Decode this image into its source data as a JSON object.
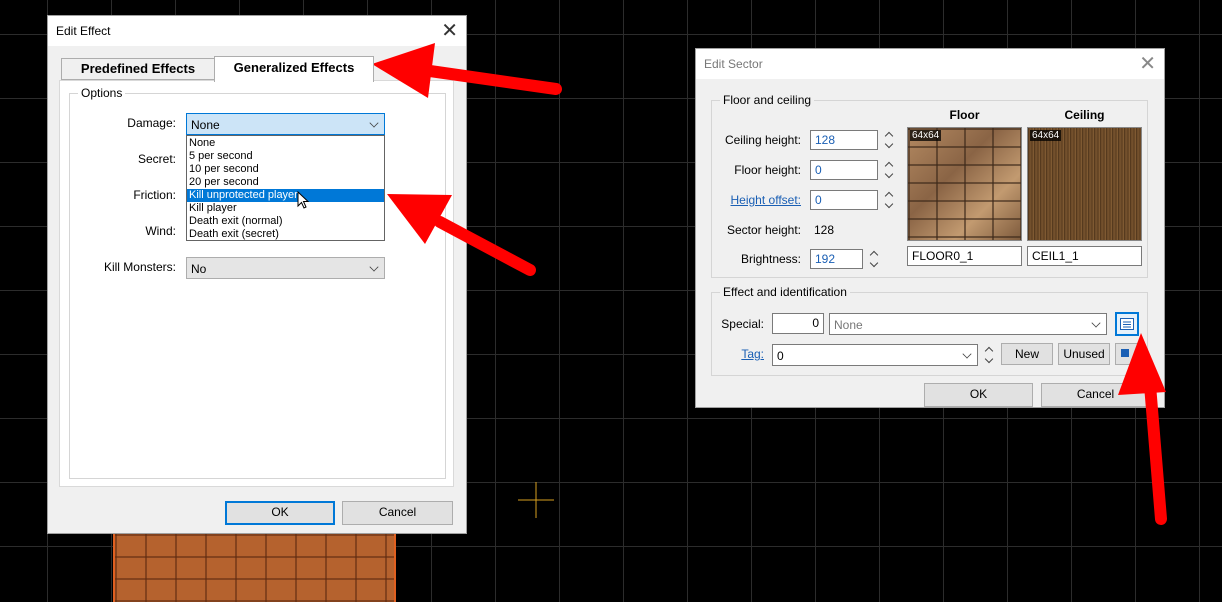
{
  "edit_effect": {
    "title": "Edit Effect",
    "close": "✕",
    "tabs": [
      "Predefined Effects",
      "Generalized Effects"
    ],
    "options_label": "Options",
    "damage_label": "Damage:",
    "damage_value": "None",
    "damage_options": [
      "None",
      "5 per second",
      "10 per second",
      "20 per second",
      "Kill unprotected player",
      "Kill player",
      "Death exit (normal)",
      "Death exit (secret)"
    ],
    "secret_label": "Secret:",
    "friction_label": "Friction:",
    "wind_label": "Wind:",
    "kill_monsters_label": "Kill Monsters:",
    "kill_monsters_value": "No",
    "ok": "OK",
    "cancel": "Cancel"
  },
  "edit_sector": {
    "title": "Edit Sector",
    "close": "✕",
    "floor_ceiling_label": "Floor and ceiling",
    "ceiling_height_label": "Ceiling height:",
    "ceiling_height": "128",
    "floor_height_label": "Floor height:",
    "floor_height": "0",
    "height_offset_label": "Height offset:",
    "height_offset": "0",
    "sector_height_label": "Sector height:",
    "sector_height": "128",
    "brightness_label": "Brightness:",
    "brightness": "192",
    "floor_header": "Floor",
    "ceiling_header": "Ceiling",
    "floor_size": "64x64",
    "ceiling_size": "64x64",
    "floor_texture": "FLOOR0_1",
    "ceiling_texture": "CEIL1_1",
    "effect_ident_label": "Effect and identification",
    "special_label": "Special:",
    "special_value": "0",
    "special_name": "None",
    "tag_label": "Tag:",
    "tag_value": "0",
    "new_button": "New",
    "unused_button": "Unused",
    "ok": "OK",
    "cancel": "Cancel"
  },
  "colors": {
    "arrow": "#ff0000",
    "selection": "#0078d7",
    "cursor_cross": "#d8a020"
  }
}
